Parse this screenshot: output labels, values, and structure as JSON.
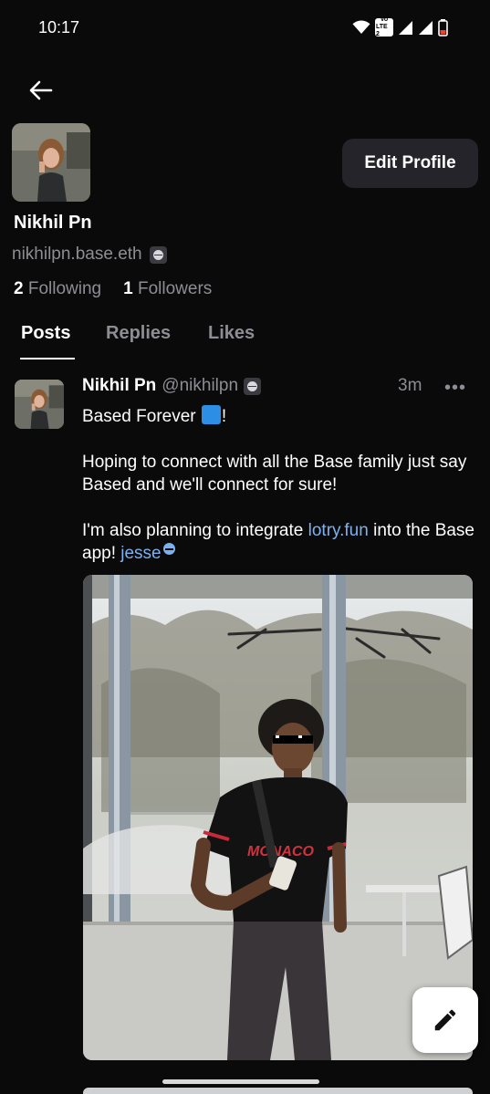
{
  "status_bar": {
    "time": "10:17",
    "icons": [
      "wifi-icon",
      "volte-icon",
      "signal-icon",
      "signal-icon",
      "battery-icon"
    ],
    "volte_text": [
      "Vo",
      "LTE 2"
    ]
  },
  "header": {
    "back_icon": "arrow-left-icon"
  },
  "profile": {
    "name": "Nikhil Pn",
    "handle": "nikhilpn.base.eth",
    "edit_label": "Edit Profile",
    "following_count": "2",
    "following_label": "Following",
    "followers_count": "1",
    "followers_label": "Followers"
  },
  "tabs": [
    {
      "label": "Posts",
      "active": true
    },
    {
      "label": "Replies",
      "active": false
    },
    {
      "label": "Likes",
      "active": false
    }
  ],
  "post": {
    "author": "Nikhil Pn",
    "handle": "@nikhilpn",
    "time": "3m",
    "more": "•••",
    "line1_text": "Based Forever",
    "line1_suffix": "!",
    "paragraph2": "Hoping to connect with all the Base family just say Based and we'll connect for sure!",
    "paragraph3_prefix": "I'm also planning to integrate ",
    "paragraph3_link": "lotry.fun",
    "paragraph3_mid": " into the Base app! ",
    "paragraph3_mention": "jesse"
  },
  "fab": {
    "icon": "pencil-icon"
  },
  "colors": {
    "background": "#0a0a0b",
    "accent_link": "#7fb0ee",
    "muted_text": "#8d8d94",
    "button_bg": "#24242a",
    "base_blue": "#2d8ee6"
  }
}
